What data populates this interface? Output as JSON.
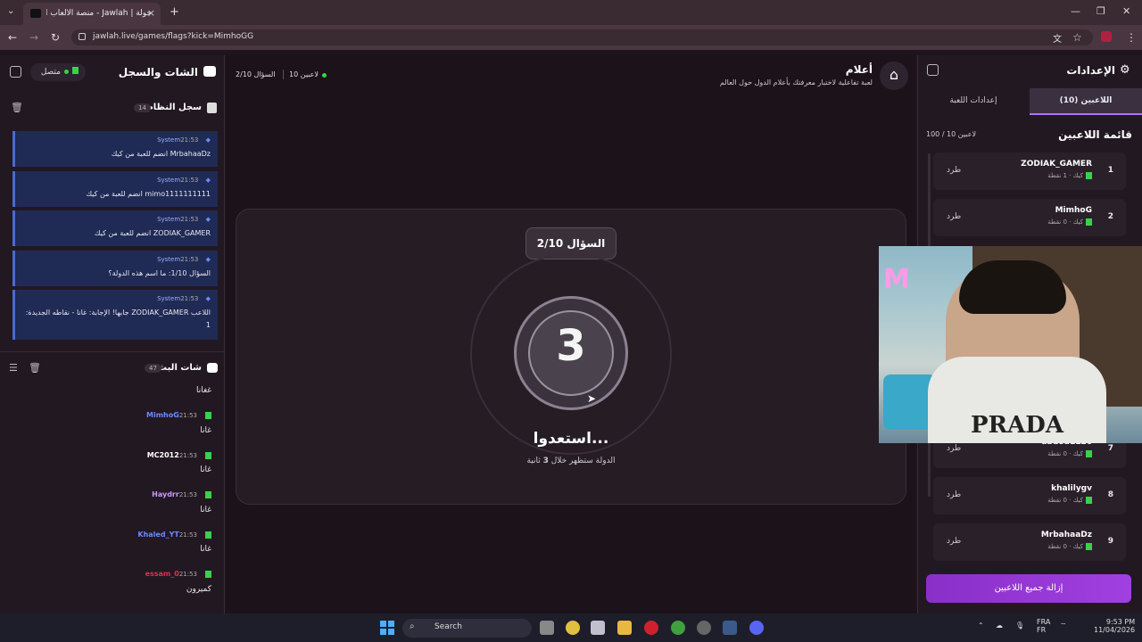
{
  "browser": {
    "tab_title": "جولة | Jawlah - منصة الألعاب الت...",
    "url": "jawlah.live/games/flags?kick=MimhoGG",
    "new_tab": "+",
    "close_tab": "×"
  },
  "left_panel": {
    "title": "الشات والسجل",
    "status": "متصل",
    "system_log": {
      "title": "سجل النظام",
      "count": "14",
      "messages": [
        {
          "sender": "System",
          "time": "21:53",
          "text": "MrbahaaDz انضم للعبة من كيك"
        },
        {
          "sender": "System",
          "time": "21:53",
          "text": "mimo1111111111 انضم للعبة من كيك"
        },
        {
          "sender": "System",
          "time": "21:53",
          "text": "ZODIAK_GAMER انضم للعبة من كيك"
        },
        {
          "sender": "System",
          "time": "21:53",
          "text": "السؤال 1/10: ما اسم هذه الدولة؟"
        },
        {
          "sender": "System",
          "time": "21:53",
          "text": "اللاعب ZODIAK_GAMER جابها! الإجابة: غانا - نقاطه الجديدة: 1"
        }
      ]
    },
    "stream_chat": {
      "title": "شات البث",
      "count": "47",
      "top_line": "غغانا",
      "messages": [
        {
          "user": "MimhoG",
          "time": "21:53",
          "text": "غانا",
          "color": "#6a8aff"
        },
        {
          "user": "MC2012",
          "time": "21:53",
          "text": "غانا",
          "color": "#ffffff"
        },
        {
          "user": "Haydrr",
          "time": "21:53",
          "text": "غانا",
          "color": "#c89aff"
        },
        {
          "user": "Khaled_YT",
          "time": "21:53",
          "text": "غانا",
          "color": "#6a8aff"
        },
        {
          "user": "essam_0",
          "time": "21:53",
          "text": "كميرون",
          "color": "#e03050"
        }
      ]
    }
  },
  "center": {
    "game_title": "أعلام",
    "game_subtitle": "لعبة تفاعلية لاختبار معرفتك بأعلام الدول حول العالم",
    "players_count": "10 لاعبين",
    "question_header": "السؤال 2/10",
    "question_pill": "السؤال 2/10",
    "countdown": "3",
    "ready_text": "استعدوا...",
    "sub_text_a": "الدولة ستظهر خلال ",
    "sub_seconds": "3",
    "sub_text_b": " ثانية"
  },
  "right_panel": {
    "title": "الإعدادات",
    "tab_players": "اللاعبين (10)",
    "tab_settings": "إعدادات اللعبة",
    "list_title": "قائمة اللاعبين",
    "list_count": "100 / 10 لاعبين",
    "kick_label": "طرد",
    "players": [
      {
        "idx": "1",
        "name": "ZODIAK_GAMER",
        "platform": "كيك",
        "points": "1 نقطة"
      },
      {
        "idx": "2",
        "name": "MimhoG",
        "platform": "كيك",
        "points": "0 نقطة"
      },
      {
        "idx": "7",
        "name": "abdou1126",
        "platform": "كيك",
        "points": "0 نقطة"
      },
      {
        "idx": "8",
        "name": "khalilygv",
        "platform": "كيك",
        "points": "0 نقطة"
      },
      {
        "idx": "9",
        "name": "MrbahaaDz",
        "platform": "كيك",
        "points": "0 نقطة"
      }
    ],
    "remove_all": "إزالة جميع اللاعبين"
  },
  "webcam": {
    "shirt_text": "PRADA"
  },
  "taskbar": {
    "search": "Search",
    "lang1": "FRA",
    "lang2": "FR",
    "time": "9:53 PM",
    "date": "11/04/2026"
  }
}
